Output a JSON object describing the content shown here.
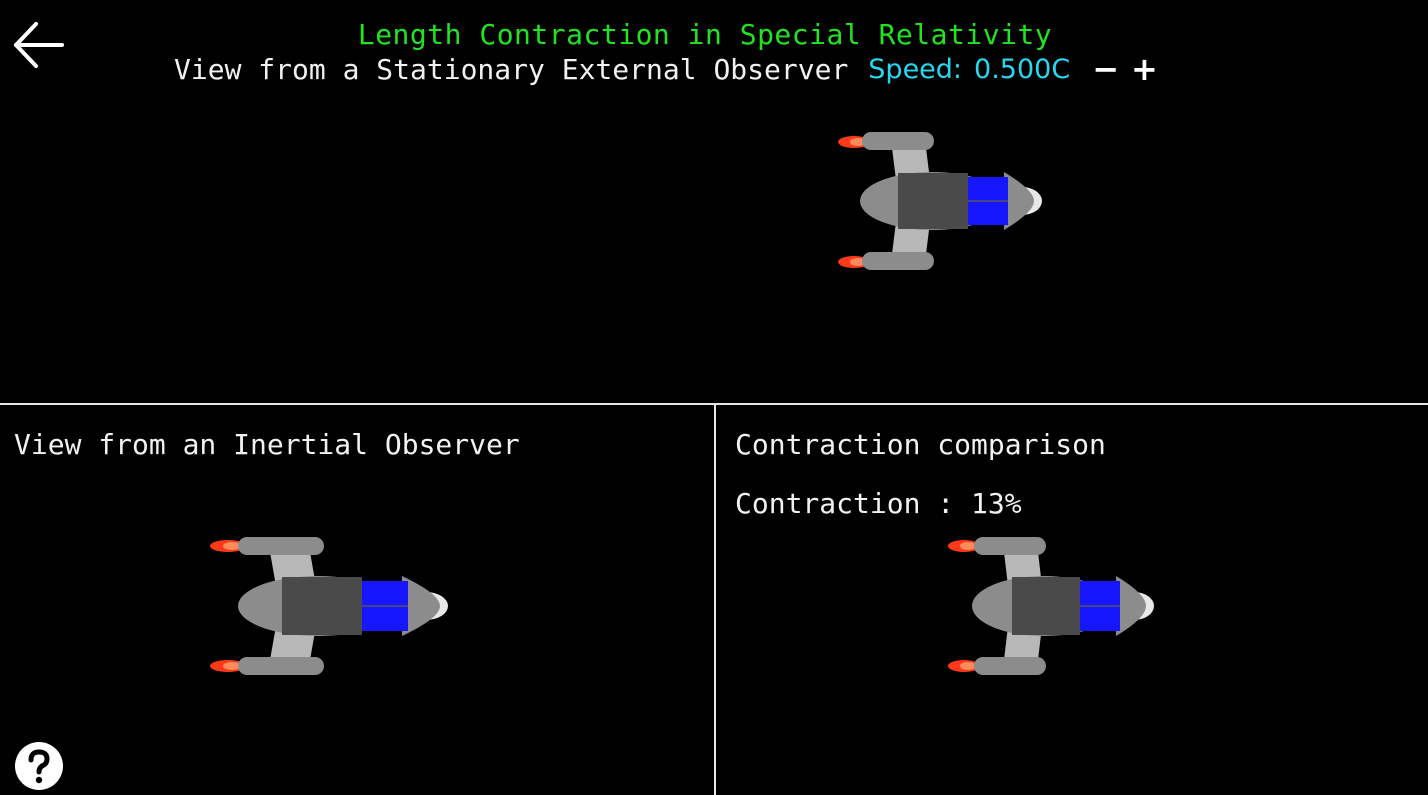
{
  "header": {
    "title": "Length Contraction in Special Relativity",
    "subtitle": "View from a Stationary External Observer",
    "speed_label": "Speed:",
    "speed_value": "0.500C",
    "minus_label": "−",
    "plus_label": "+"
  },
  "panels": {
    "inertial": {
      "title": "View from an Inertial Observer"
    },
    "comparison": {
      "title": "Contraction comparison",
      "contraction_text": "Contraction : 13%"
    }
  },
  "icons": {
    "back": "back-arrow-icon",
    "help": "help-question-icon"
  },
  "colors": {
    "title": "#22e322",
    "speed": "#26d7f0",
    "text": "#f2f2f2",
    "ship_body": "#8c8c8c",
    "ship_cabin": "#4a4a4a",
    "ship_window": "#1616ff",
    "engine_flame": "#ff3a1a"
  }
}
